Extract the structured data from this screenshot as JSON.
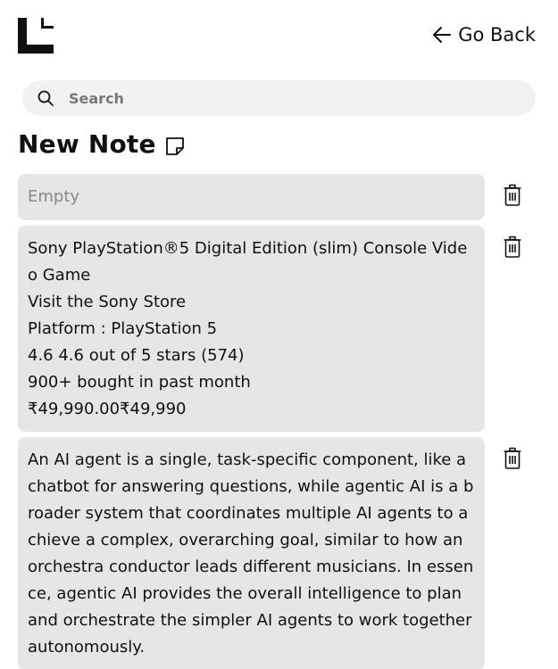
{
  "header": {
    "go_back_label": "Go Back"
  },
  "search": {
    "placeholder": "Search",
    "value": ""
  },
  "page_title": "New Note",
  "icons": {
    "logo": "logo-icon",
    "go_back": "arrow-left-icon",
    "search": "search-icon",
    "new_note": "sticky-note-icon",
    "delete": "trash-icon"
  },
  "notes": [
    {
      "text": "Empty",
      "is_placeholder": true
    },
    {
      "text": "Sony PlayStation®5 Digital Edition (slim) Console Video Game\nVisit the Sony Store\nPlatform : PlayStation 5\n4.6 4.6 out of 5 stars (574)\n900+ bought in past month\n₹49,990.00₹49,990",
      "is_placeholder": false
    },
    {
      "text": "An AI agent is a single, task-specific component, like a chatbot for answering questions, while agentic AI is a broader system that coordinates multiple AI agents to achieve a complex, overarching goal, similar to how an orchestra conductor leads different musicians. In essence, agentic AI provides the overall intelligence to plan and orchestrate the simpler AI agents to work together autonomously.",
      "is_placeholder": false
    }
  ],
  "colors": {
    "card_background": "#e6e6e6",
    "search_background": "#f2f2f2",
    "text": "#111111",
    "placeholder_text": "#888888"
  }
}
